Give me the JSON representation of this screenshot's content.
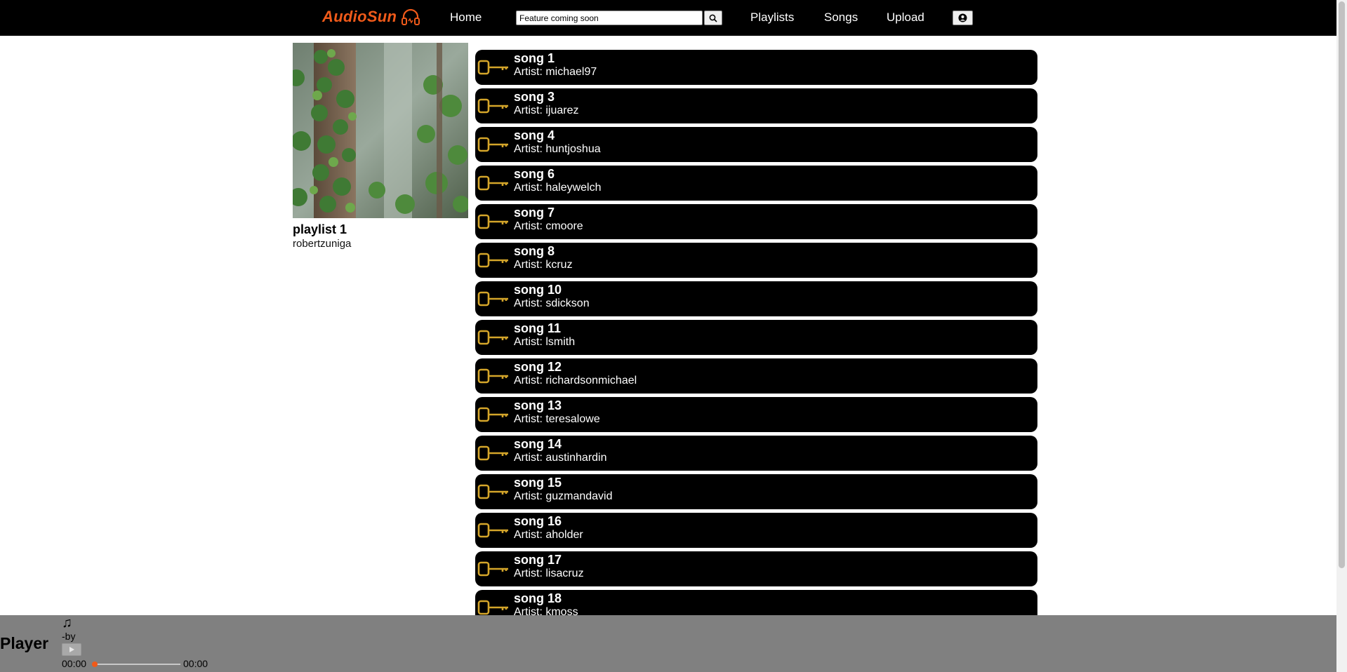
{
  "nav": {
    "brand": "AudioSun",
    "home": "Home",
    "search_value": "Feature coming soon",
    "playlists": "Playlists",
    "songs": "Songs",
    "upload": "Upload"
  },
  "playlist": {
    "title": "playlist 1",
    "owner": "robertzuniga"
  },
  "songs": [
    {
      "title": "song 1",
      "artist": "Artist: michael97"
    },
    {
      "title": "song 3",
      "artist": "Artist: ijuarez"
    },
    {
      "title": "song 4",
      "artist": "Artist: huntjoshua"
    },
    {
      "title": "song 6",
      "artist": "Artist: haleywelch"
    },
    {
      "title": "song 7",
      "artist": "Artist: cmoore"
    },
    {
      "title": "song 8",
      "artist": "Artist: kcruz"
    },
    {
      "title": "song 10",
      "artist": "Artist: sdickson"
    },
    {
      "title": "song 11",
      "artist": "Artist: lsmith"
    },
    {
      "title": "song 12",
      "artist": "Artist: richardsonmichael"
    },
    {
      "title": "song 13",
      "artist": "Artist: teresalowe"
    },
    {
      "title": "song 14",
      "artist": "Artist: austinhardin"
    },
    {
      "title": "song 15",
      "artist": "Artist: guzmandavid"
    },
    {
      "title": "song 16",
      "artist": "Artist: aholder"
    },
    {
      "title": "song 17",
      "artist": "Artist: lisacruz"
    },
    {
      "title": "song 18",
      "artist": "Artist: kmoss"
    }
  ],
  "player": {
    "label": "Player",
    "note_glyph": "♫",
    "by": "-by",
    "current_time": "00:00",
    "total_time": "00:00",
    "progress": 0
  },
  "colors": {
    "brand": "#f05a1a",
    "navbar": "#000000",
    "player_bg": "#808080",
    "song_icon": "#d4a52a"
  },
  "icons": {
    "logo": "headphones-icon",
    "search": "search-icon",
    "account": "user-circle-icon",
    "song": "key-icon",
    "play": "play-icon"
  }
}
